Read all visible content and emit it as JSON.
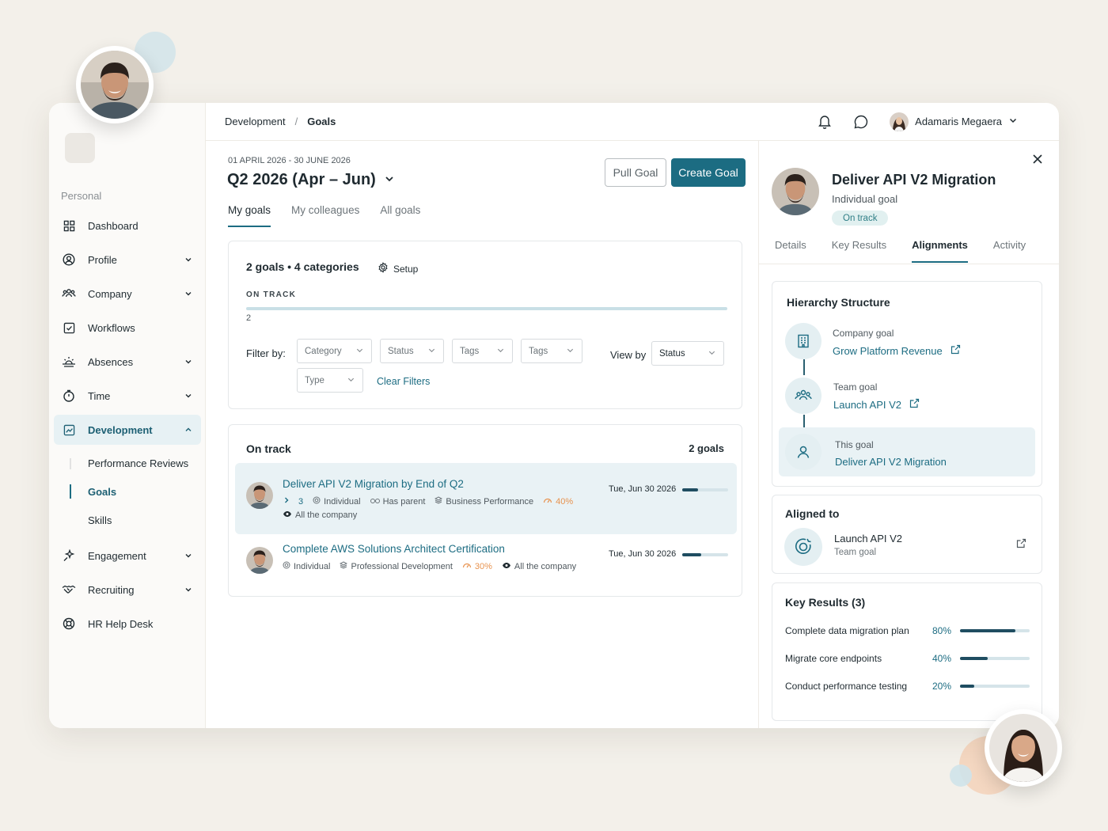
{
  "sidebar": {
    "section": "Personal",
    "items": [
      {
        "label": "Dashboard",
        "icon": "dashboard-grid-icon",
        "chevron": false
      },
      {
        "label": "Profile",
        "icon": "profile-icon",
        "chevron": true
      },
      {
        "label": "Company",
        "icon": "company-people-icon",
        "chevron": true
      },
      {
        "label": "Workflows",
        "icon": "checkbox-icon",
        "chevron": false
      },
      {
        "label": "Absences",
        "icon": "sun-horizon-icon",
        "chevron": true
      },
      {
        "label": "Time",
        "icon": "stopwatch-icon",
        "chevron": true
      },
      {
        "label": "Development",
        "icon": "chart-icon",
        "chevron": true,
        "active": true
      },
      {
        "label": "Engagement",
        "icon": "sparkle-icon",
        "chevron": true
      },
      {
        "label": "Recruiting",
        "icon": "handshake-icon",
        "chevron": true
      },
      {
        "label": "HR Help Desk",
        "icon": "lifebuoy-icon",
        "chevron": false
      }
    ],
    "development_sub": [
      "Performance Reviews",
      "Goals",
      "Skills"
    ]
  },
  "topbar": {
    "breadcrumb": [
      "Development",
      "Goals"
    ],
    "user_name": "Adamaris Megaera"
  },
  "period": {
    "dates": "01 APRIL 2026 - 30 JUNE 2026",
    "title": "Q2 2026 (Apr – Jun)"
  },
  "actions": {
    "pull": "Pull Goal",
    "create": "Create Goal"
  },
  "tabs": [
    "My goals",
    "My colleagues",
    "All goals"
  ],
  "summary": {
    "count": "2 goals • 4 categories",
    "setup": "Setup",
    "status": "ON TRACK",
    "status_count": "2",
    "filter_label": "Filter by:",
    "filters": [
      "Category",
      "Status",
      "Tags",
      "Tags",
      "Type"
    ],
    "clear": "Clear Filters",
    "view_by_label": "View by",
    "view_by_value": "Status"
  },
  "goals": {
    "group_title": "On track",
    "group_count": "2 goals",
    "items": [
      {
        "title": "Deliver API V2 Migration by End of Q2",
        "children": "3",
        "type": "Individual",
        "parent": "Has parent",
        "category": "Business Performance",
        "weight": "40%",
        "visibility": "All the company",
        "date": "Tue, Jun 30 2026",
        "progress": 0.35
      },
      {
        "title": "Complete AWS Solutions Architect Certification",
        "type": "Individual",
        "category": "Professional Development",
        "weight": "30%",
        "visibility": "All the company",
        "date": "Tue, Jun 30 2026",
        "progress": 0.42
      }
    ]
  },
  "detail": {
    "title": "Deliver API V2 Migration",
    "subtitle": "Individual goal",
    "status": "On track",
    "tabs": [
      "Details",
      "Key Results",
      "Alignments",
      "Activity"
    ],
    "hierarchy": {
      "title": "Hierarchy Structure",
      "company_label": "Company goal",
      "company_goal": "Grow Platform Revenue",
      "team_label": "Team goal",
      "team_goal": "Launch API V2",
      "this_label": "This goal",
      "this_goal": "Deliver API V2 Migration"
    },
    "aligned": {
      "title": "Aligned to",
      "name": "Launch API V2",
      "type": "Team goal"
    },
    "key_results": {
      "title": "Key Results (3)",
      "items": [
        {
          "name": "Complete data migration plan",
          "pct": "80%",
          "value": 0.8
        },
        {
          "name": "Migrate core endpoints",
          "pct": "40%",
          "value": 0.4
        },
        {
          "name": "Conduct performance testing",
          "pct": "20%",
          "value": 0.2
        }
      ]
    }
  },
  "colors": {
    "accent": "#1c6c82",
    "accent_dark": "#1f4d61",
    "orange": "#e8934f"
  }
}
